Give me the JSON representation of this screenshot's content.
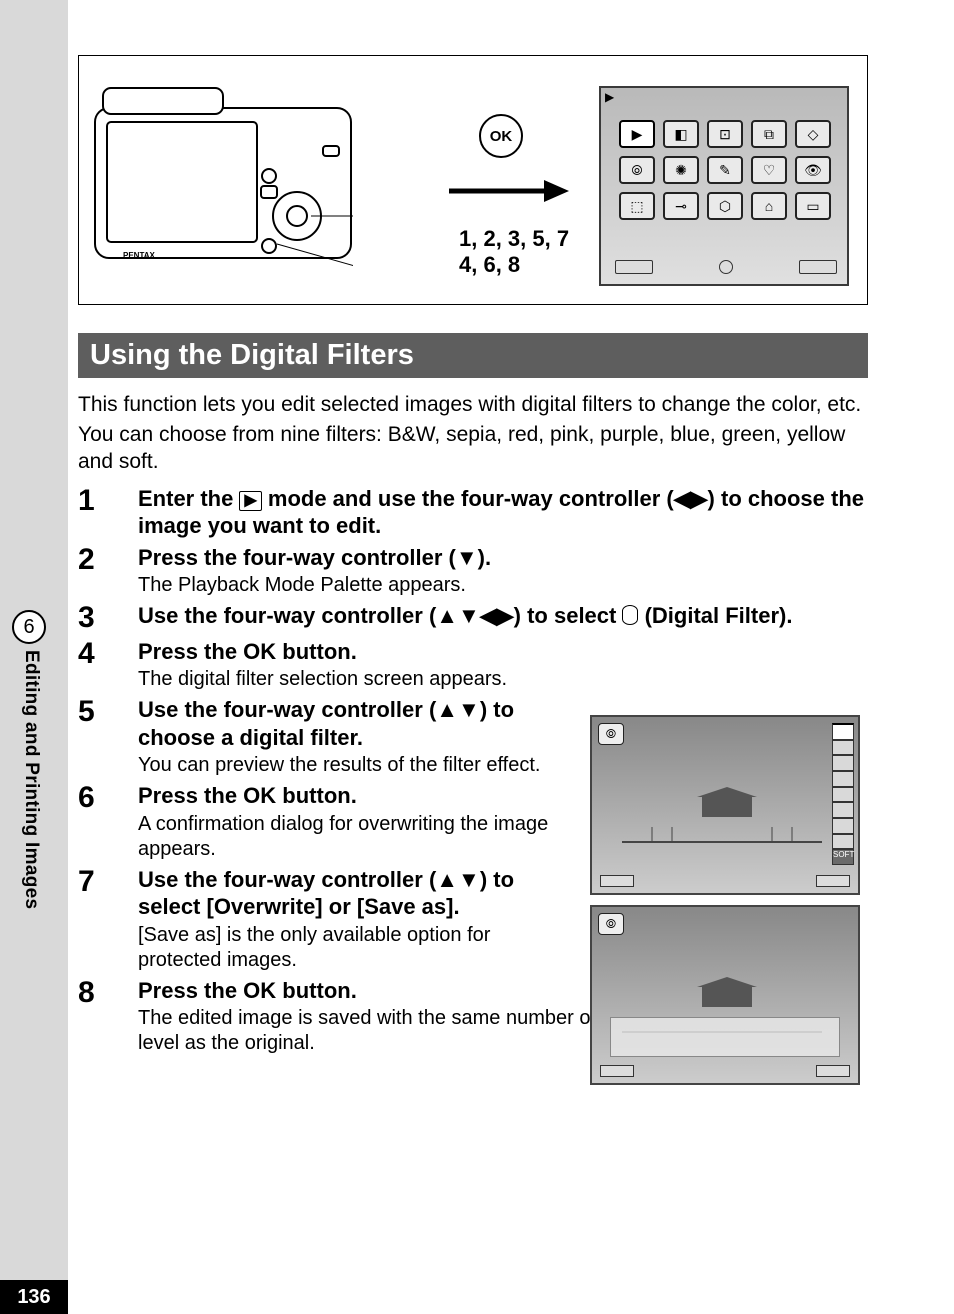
{
  "page_number": "136",
  "side_tab": {
    "chapter_num": "6",
    "chapter_title": "Editing and Printing Images"
  },
  "figure": {
    "ok_label": "OK",
    "step_line1": "1, 2, 3, 5, 7",
    "step_line2": "4, 6, 8",
    "palette_icons": [
      "▶",
      "◧",
      "⊡",
      "⧉",
      "◇",
      "⦾",
      "✺",
      "✎",
      "♡",
      "👁",
      "⬚",
      "⊸",
      "⬡",
      "⌂",
      "▭"
    ]
  },
  "heading": "Using the Digital Filters",
  "intro1": "This function lets you edit selected images with digital filters to change the color, etc.",
  "intro2": "You can choose from nine filters: B&W, sepia, red, pink, purple, blue, green, yellow and soft.",
  "steps": {
    "s1": {
      "head_a": "Enter the ",
      "head_b": " mode and use the four-way controller (◀▶) to choose the image you want to edit."
    },
    "s2": {
      "head": "Press the four-way controller (▼).",
      "sub": "The Playback Mode Palette appears."
    },
    "s3": {
      "head_a": "Use the four-way controller (▲▼◀▶) to select ",
      "head_b": " (Digital Filter)."
    },
    "s4": {
      "head_a": "Press the ",
      "ok": "OK",
      "head_b": " button.",
      "sub": "The digital filter selection screen appears."
    },
    "s5": {
      "head": "Use the four-way controller (▲▼) to choose a digital filter.",
      "sub": "You can preview the results of the filter effect."
    },
    "s6": {
      "head_a": "Press the ",
      "ok": "OK",
      "head_b": " button.",
      "sub": "A confirmation dialog for overwriting the image appears."
    },
    "s7": {
      "head": "Use the four-way controller (▲▼) to select [Overwrite] or [Save as].",
      "sub": "[Save as] is the only available option for protected images."
    },
    "s8": {
      "head_a": "Press the ",
      "ok": "OK",
      "head_b": " button.",
      "sub": "The edited image is saved with the same number of recorded pixels and quality level as the original."
    }
  },
  "nums": {
    "n1": "1",
    "n2": "2",
    "n3": "3",
    "n4": "4",
    "n5": "5",
    "n6": "6",
    "n7": "7",
    "n8": "8"
  },
  "scr_labels": {
    "soft": "SOFT",
    "filter_glyph": "⦾"
  }
}
